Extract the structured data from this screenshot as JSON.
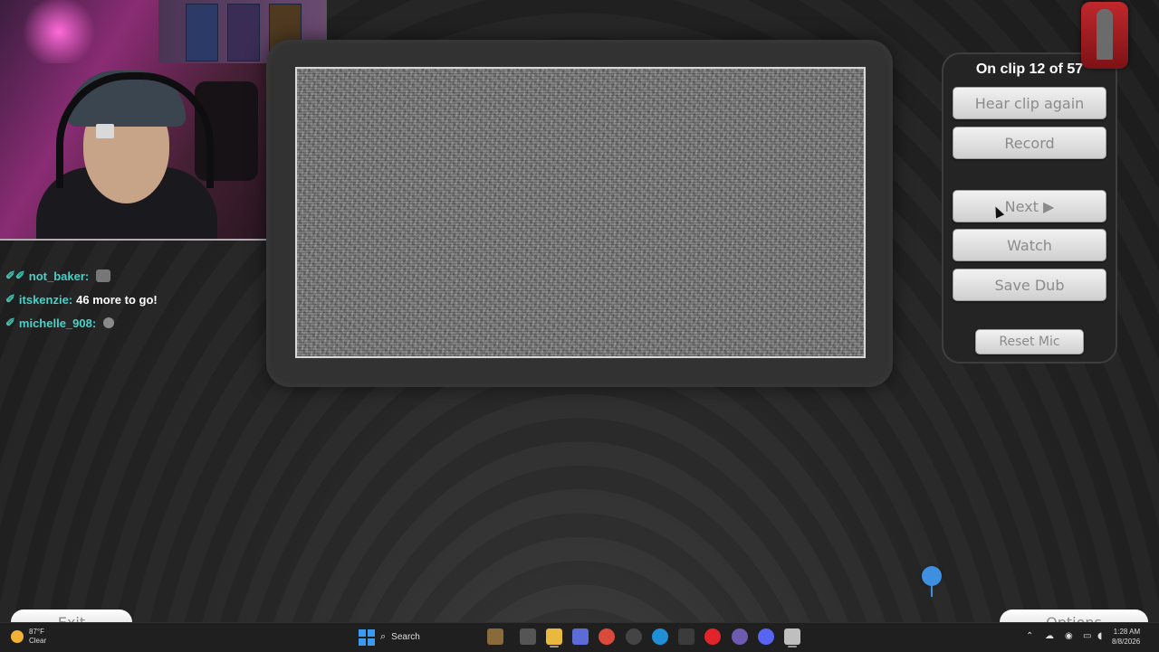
{
  "chat": [
    {
      "user": "not_baker:",
      "message": ""
    },
    {
      "user": "itskenzie:",
      "message": "46 more to go!"
    },
    {
      "user": "michelle_908:",
      "message": ""
    }
  ],
  "panel": {
    "clip_status": "On clip 12 of 57",
    "hear_again": "Hear clip again",
    "record": "Record",
    "next": "Next ▶",
    "watch": "Watch",
    "save_dub": "Save Dub",
    "reset_mic": "Reset Mic"
  },
  "bottom": {
    "left_button": "Exit",
    "right_button": "Options"
  },
  "taskbar": {
    "temperature": "87°F",
    "condition": "Clear",
    "search_placeholder": "Search",
    "time": "1:28 AM",
    "date": "8/8/2026"
  },
  "colors": {
    "chat_username": "#49d1c8",
    "button_text": "#8b8b8b",
    "mic_pin": "#3e8fe0",
    "logo_red": "#c0282c"
  }
}
